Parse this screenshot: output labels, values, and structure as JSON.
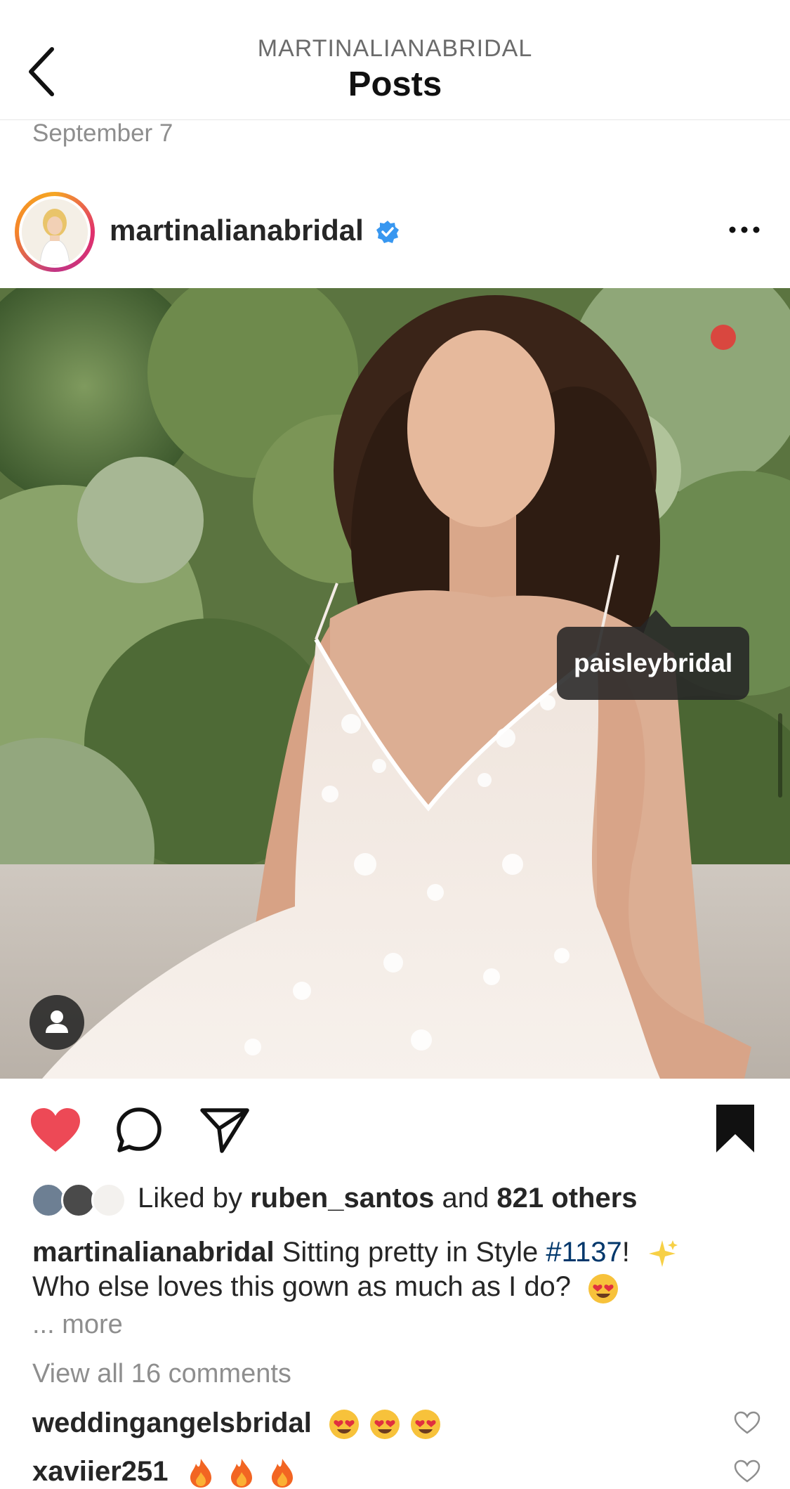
{
  "header": {
    "subtitle": "MARTINALIANABRIDAL",
    "title": "Posts"
  },
  "post": {
    "date": "September 7",
    "username": "martinalianabridal",
    "verified": true,
    "photo_tag": "paisleybridal",
    "likes": {
      "prefix": "Liked by",
      "user": "ruben_santos",
      "and": "and",
      "others": "821 others"
    },
    "caption": {
      "username": "martinalianabridal",
      "text_before_hash": "Sitting pretty in Style",
      "hashtag": "#1137",
      "text_after_hash": "!",
      "line2": "Who else loves this gown as much as I do?"
    },
    "more_label": "... more",
    "view_comments": "View all 16 comments",
    "comments": [
      {
        "username": "weddingangelsbridal",
        "emoji": [
          "heart-eyes",
          "heart-eyes",
          "heart-eyes"
        ]
      },
      {
        "username": "xaviier251",
        "emoji": [
          "fire",
          "fire",
          "fire"
        ]
      }
    ],
    "icons": {
      "back": "chevron-left-icon",
      "more": "ellipsis-icon",
      "like": "heart-filled-icon",
      "comment": "comment-bubble-icon",
      "share": "paper-plane-icon",
      "save": "bookmark-filled-icon",
      "user_tags": "person-icon"
    },
    "colors": {
      "like": "#ed4956",
      "verified": "#3897f0",
      "hashtag": "#00376b"
    }
  }
}
